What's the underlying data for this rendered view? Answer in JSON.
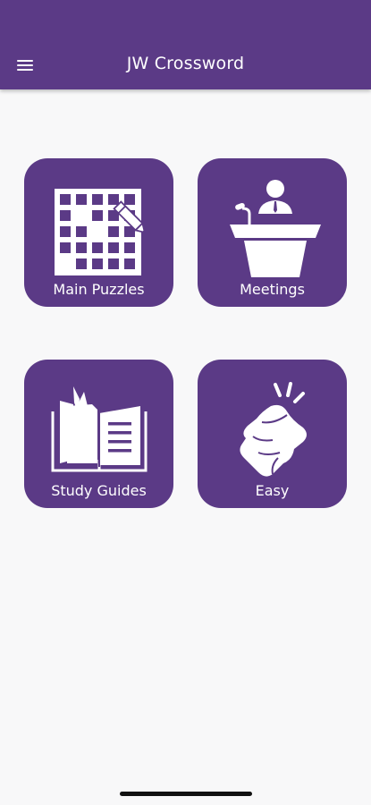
{
  "app": {
    "title": "JW Crossword",
    "accent_color": "#5b3a86",
    "menu_icon": "hamburger-menu-icon"
  },
  "tiles": [
    {
      "label": "Main Puzzles",
      "icon": "crossword-grid-pencil-icon"
    },
    {
      "label": "Meetings",
      "icon": "speaker-podium-icon"
    },
    {
      "label": "Study Guides",
      "icon": "open-book-icon"
    },
    {
      "label": "Easy",
      "icon": "finger-snap-icon"
    }
  ]
}
